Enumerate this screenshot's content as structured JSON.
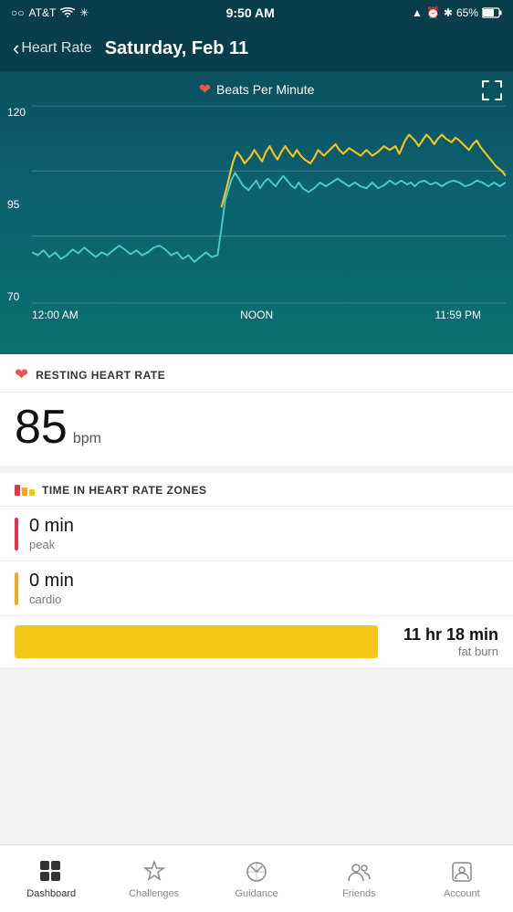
{
  "statusBar": {
    "carrier": "AT&T",
    "time": "9:50 AM",
    "battery": "65%",
    "signal_dots": "○○●●●"
  },
  "nav": {
    "back_label": "Heart Rate",
    "title": "Saturday, Feb 11"
  },
  "chart": {
    "legend_label": "Beats Per Minute",
    "y_labels": [
      "120",
      "95",
      "70"
    ],
    "x_labels": [
      "12:00 AM",
      "NOON",
      "11:59 PM"
    ],
    "expand_icon": "⤢"
  },
  "resting": {
    "icon": "❤",
    "title": "RESTING HEART RATE",
    "value": "85",
    "unit": "bpm"
  },
  "zones": {
    "title": "TIME IN HEART RATE ZONES",
    "items": [
      {
        "label": "0 min",
        "sublabel": "peak",
        "color": "#e8334a"
      },
      {
        "label": "0 min",
        "sublabel": "cardio",
        "color": "#f5a623"
      },
      {
        "label": "11 hr 18 min",
        "sublabel": "fat burn",
        "color": "#f5c518"
      }
    ]
  },
  "tabs": [
    {
      "id": "dashboard",
      "label": "Dashboard",
      "active": true
    },
    {
      "id": "challenges",
      "label": "Challenges",
      "active": false
    },
    {
      "id": "guidance",
      "label": "Guidance",
      "active": false
    },
    {
      "id": "friends",
      "label": "Friends",
      "active": false
    },
    {
      "id": "account",
      "label": "Account",
      "active": false
    }
  ]
}
